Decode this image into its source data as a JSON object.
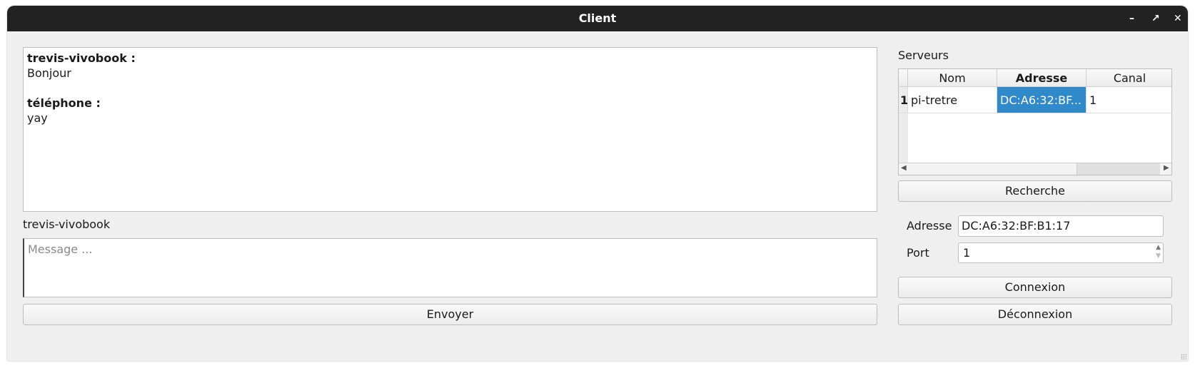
{
  "window": {
    "title": "Client"
  },
  "chat": {
    "messages": [
      {
        "sender": "trevis-vivobook :",
        "text": "Bonjour"
      },
      {
        "sender": "téléphone :",
        "text": "yay"
      }
    ]
  },
  "user_label": "trevis-vivobook",
  "message_input": {
    "placeholder": "Message ...",
    "value": ""
  },
  "send_label": "Envoyer",
  "servers": {
    "label": "Serveurs",
    "columns": [
      "Nom",
      "Adresse",
      "Canal"
    ],
    "rows": [
      {
        "index": "1",
        "name": "pi-tretre",
        "address": "DC:A6:32:BF...",
        "channel": "1"
      }
    ]
  },
  "search_label": "Recherche",
  "address": {
    "label": "Adresse",
    "value": "DC:A6:32:BF:B1:17"
  },
  "port": {
    "label": "Port",
    "value": "1"
  },
  "connect_label": "Connexion",
  "disconnect_label": "Déconnexion",
  "colors": {
    "selection": "#3089c8",
    "titlebar": "#222222"
  }
}
